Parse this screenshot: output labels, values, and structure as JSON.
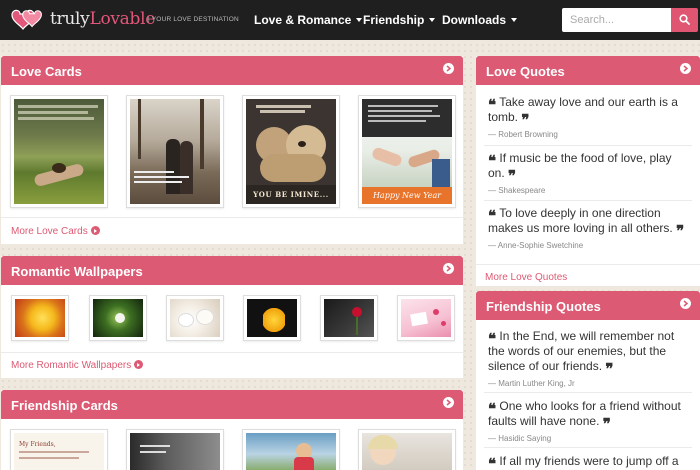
{
  "brand": {
    "name_part1": "truly",
    "name_part2": "Lovable",
    "tagline": "| YOUR LOVE DESTINATION"
  },
  "nav": {
    "items": [
      {
        "label": "Love & Romance"
      },
      {
        "label": "Friendship"
      },
      {
        "label": "Downloads"
      }
    ],
    "search_placeholder": "Search..."
  },
  "love_cards": {
    "title": "Love Cards",
    "more_label": "More Love Cards",
    "thumbnails": [
      "couple-on-grass-card",
      "couple-walking-autumn-card",
      "teddy-bears-card",
      "happy-new-year-card"
    ],
    "card_captions": [
      "YOU BE IMINE...",
      "Happy New Year"
    ]
  },
  "romantic_wallpapers": {
    "title": "Romantic Wallpapers",
    "more_label": "More Romantic Wallpapers",
    "thumbnails": [
      "yellow-rose",
      "green-leaf",
      "white-roses",
      "yellow-lily",
      "red-rose-dark",
      "pink-hearts"
    ]
  },
  "friendship_cards": {
    "title": "Friendship Cards",
    "thumbnails": [
      "my-friends-card",
      "street-card",
      "children-card",
      "child-card"
    ],
    "card_captions": [
      "My Friends,"
    ]
  },
  "love_quotes": {
    "title": "Love Quotes",
    "more_label": "More Love Quotes",
    "items": [
      {
        "text": "Take away love and our earth is a tomb.",
        "author": "— Robert Browning"
      },
      {
        "text": "If music be the food of love, play on.",
        "author": "— Shakespeare"
      },
      {
        "text": "To love deeply in one direction makes us more loving in all others.",
        "author": "— Anne-Sophie Swetchine"
      }
    ]
  },
  "friendship_quotes": {
    "title": "Friendship Quotes",
    "items": [
      {
        "text": "In the End, we will remember not the words of our enemies, but the silence of our friends.",
        "author": "— Martin Luther King, Jr"
      },
      {
        "text": "One who looks for a friend without faults will have none.",
        "author": "— Hasidic Saying"
      },
      {
        "text": "If all my friends were to jump off a",
        "author": ""
      }
    ]
  },
  "colors": {
    "accent": "#dc5a73",
    "navbar": "#1f1f1f",
    "background": "#efe8df"
  }
}
